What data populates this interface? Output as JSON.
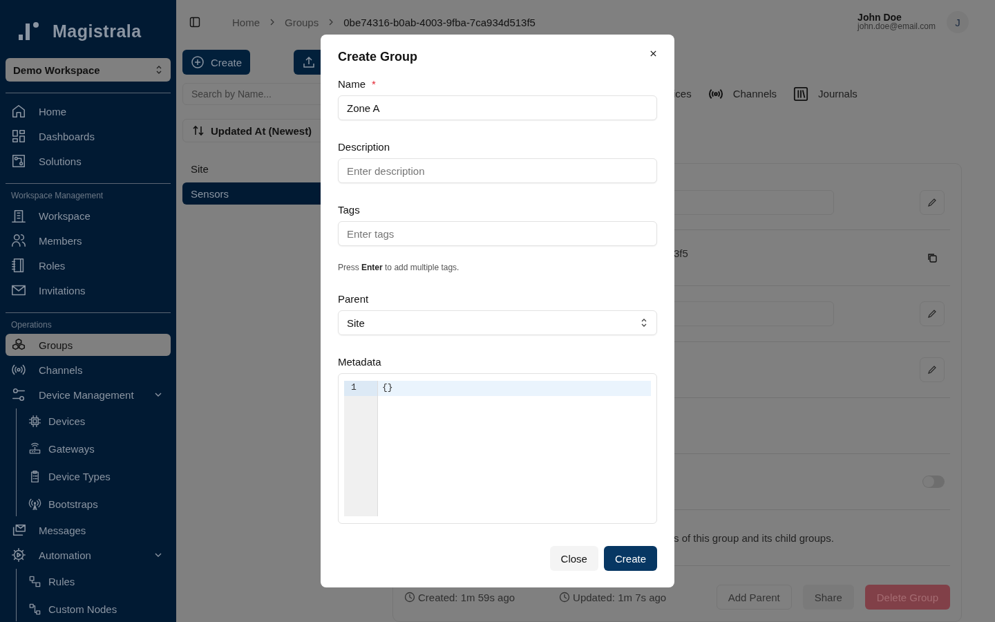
{
  "brand": {
    "name": "Magistrala"
  },
  "workspace_selector": {
    "value": "Demo Workspace"
  },
  "sidebar": {
    "sections": [
      {
        "items": [
          {
            "label": "Home",
            "selected": false
          },
          {
            "label": "Dashboards",
            "selected": false
          },
          {
            "label": "Solutions",
            "selected": false
          }
        ]
      },
      {
        "heading": "Workspace Management",
        "items": [
          {
            "label": "Workspace",
            "selected": false
          },
          {
            "label": "Members",
            "selected": false
          },
          {
            "label": "Roles",
            "selected": false
          },
          {
            "label": "Invitations",
            "selected": false
          }
        ]
      },
      {
        "heading": "Operations",
        "items": [
          {
            "label": "Groups",
            "selected": true
          },
          {
            "label": "Channels",
            "selected": false
          },
          {
            "label": "Device Management",
            "selected": false,
            "expanded": true,
            "children": [
              {
                "label": "Devices",
                "selected": false
              },
              {
                "label": "Gateways",
                "selected": false
              },
              {
                "label": "Device Types",
                "selected": false
              },
              {
                "label": "Bootstraps",
                "selected": false
              }
            ]
          },
          {
            "label": "Messages",
            "selected": false
          },
          {
            "label": "Automation",
            "selected": false,
            "expanded": true,
            "children": [
              {
                "label": "Rules",
                "selected": false
              },
              {
                "label": "Custom Nodes",
                "selected": false
              }
            ]
          }
        ]
      }
    ]
  },
  "breadcrumbs": [
    "Home",
    "Groups",
    "0be74316-b0ab-4003-9fba-7ca934d513f5"
  ],
  "user": {
    "name": "John Doe",
    "email": "john.doe@email.com",
    "initial": "J"
  },
  "groups_panel": {
    "create_button": "Create",
    "search": {
      "placeholder": "Search by Name..."
    },
    "sort": "Updated At (Newest)",
    "items": [
      {
        "label": "Site",
        "selected": false
      },
      {
        "label": "Sensors",
        "selected": true
      }
    ]
  },
  "detail": {
    "tabs": [
      {
        "label": "ices"
      },
      {
        "label": "Channels"
      },
      {
        "label": "Journals"
      }
    ],
    "rows": [
      {
        "kind": "field"
      },
      {
        "kind": "copy",
        "text": "3f5"
      },
      {
        "kind": "textarea"
      },
      {
        "kind": "edit"
      },
      {
        "kind": "empty"
      },
      {
        "kind": "toggle",
        "on": false
      },
      {
        "kind": "text",
        "text": "s of this group and its child groups."
      }
    ],
    "created": "Created: 1m 59s ago",
    "updated": "Updated: 1m 7s ago",
    "buttons": [
      {
        "label": "Add Parent",
        "kind": "outline"
      },
      {
        "label": "Share",
        "kind": "plain"
      },
      {
        "label": "Delete Group",
        "kind": "danger"
      }
    ]
  },
  "dialog": {
    "title": "Create Group",
    "name": {
      "label": "Name",
      "required": true,
      "required_mark": "*",
      "value": "Zone A"
    },
    "description": {
      "label": "Description",
      "placeholder": "Enter description"
    },
    "tags": {
      "label": "Tags",
      "placeholder": "Enter tags",
      "hint": "Press **Enter** to add multiple tags."
    },
    "parent": {
      "label": "Parent",
      "value": "Site"
    },
    "metadata": {
      "label": "Metadata",
      "lines": [
        {
          "number": "1",
          "code": "{}"
        }
      ]
    },
    "buttons": [
      {
        "label": "Close",
        "kind": "secondary"
      },
      {
        "label": "Create",
        "kind": "primary"
      }
    ]
  }
}
